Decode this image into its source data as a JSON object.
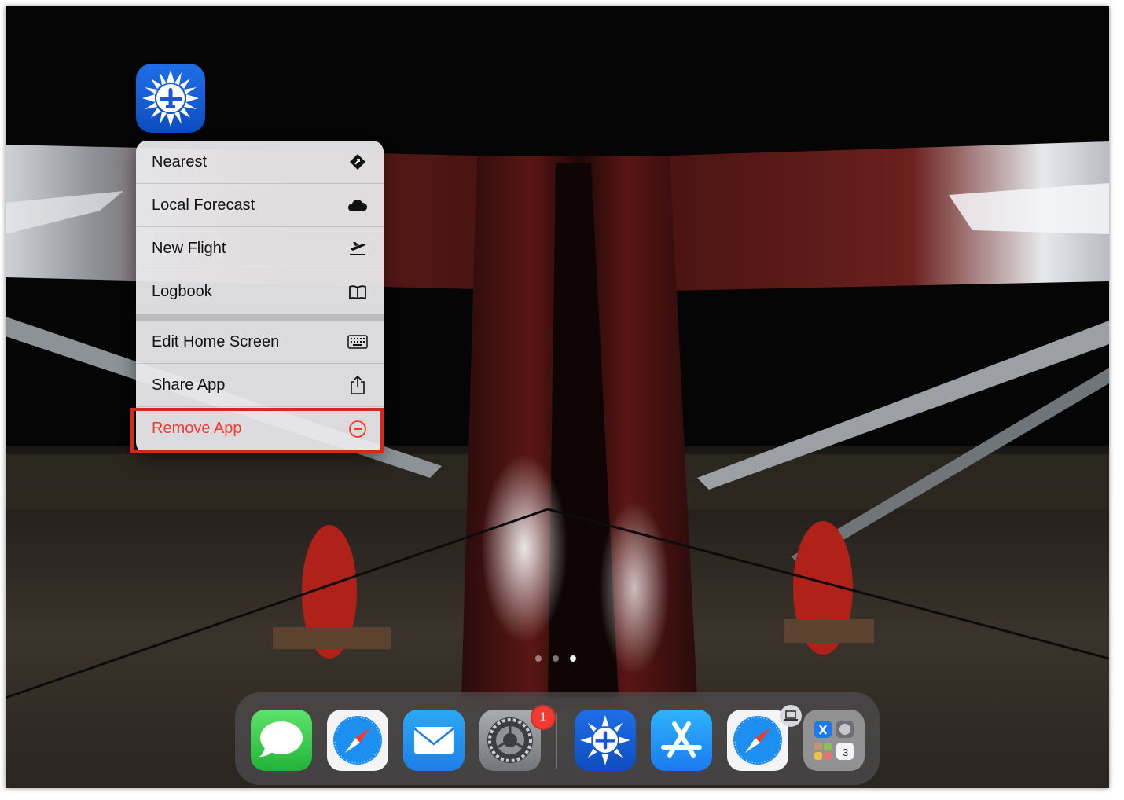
{
  "home_screen": {
    "focused_app_icon": "foreflight-sun-plane-icon"
  },
  "context_menu": {
    "items": [
      {
        "label": "Nearest",
        "icon": "nearest-diamond-icon"
      },
      {
        "label": "Local Forecast",
        "icon": "cloud-icon"
      },
      {
        "label": "New Flight",
        "icon": "plane-takeoff-icon"
      },
      {
        "label": "Logbook",
        "icon": "book-icon"
      }
    ],
    "system_items": [
      {
        "label": "Edit Home Screen",
        "icon": "keyboard-icon"
      },
      {
        "label": "Share App",
        "icon": "share-icon"
      },
      {
        "label": "Remove App",
        "icon": "minus-circle-icon",
        "destructive": true
      }
    ],
    "highlighted_item": "Remove App",
    "highlight_color": "#d9271d",
    "destructive_color": "#f23a30"
  },
  "page_indicator": {
    "pages": 3,
    "current": 3
  },
  "dock": {
    "apps": [
      {
        "name": "Messages",
        "icon": "messages-icon"
      },
      {
        "name": "Safari",
        "icon": "safari-icon"
      },
      {
        "name": "Mail",
        "icon": "mail-icon"
      },
      {
        "name": "Settings",
        "icon": "settings-gear-icon",
        "badge": "1"
      }
    ],
    "recent_apps": [
      {
        "name": "ForeFlight",
        "icon": "foreflight-sun-plane-icon"
      },
      {
        "name": "App Store",
        "icon": "app-store-icon"
      },
      {
        "name": "Safari",
        "icon": "safari-icon",
        "handoff": "laptop-icon"
      },
      {
        "name": "App Library",
        "icon": "app-library-icon",
        "mini_label": "3"
      }
    ]
  }
}
